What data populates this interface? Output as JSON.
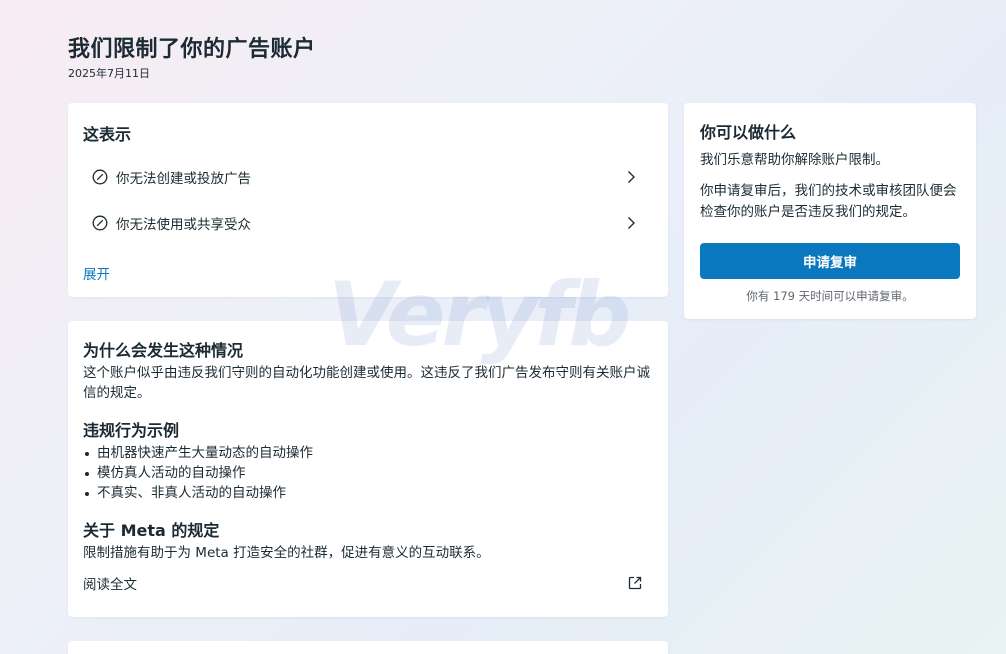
{
  "page": {
    "title": "我们限制了你的广告账户",
    "date": "2025年7月11日"
  },
  "means": {
    "heading": "这表示",
    "items": [
      {
        "label": "你无法创建或投放广告",
        "icon": "ban-icon"
      },
      {
        "label": "你无法使用或共享受众",
        "icon": "ban-icon"
      }
    ],
    "expand_label": "展开"
  },
  "why": {
    "heading": "为什么会发生这种情况",
    "body": "这个账户似乎由违反我们守则的自动化功能创建或使用。这违反了我们广告发布守则有关账户诚信的规定。",
    "examples_heading": "违规行为示例",
    "examples": [
      "由机器快速产生大量动态的自动操作",
      "模仿真人活动的自动操作",
      "不真实、非真人活动的自动操作"
    ],
    "rules_heading": "关于 Meta 的规定",
    "rules_body": "限制措施有助于为 Meta 打造安全的社群，促进有意义的互动联系。",
    "read_label": "阅读全文"
  },
  "what": {
    "heading": "你可以做什么",
    "p1": "我们乐意帮助你解除账户限制。",
    "p2": "你申请复审后，我们的技术或审核团队便会检查你的账户是否违反我们的规定。",
    "button_label": "申请复审",
    "note": "你有 179 天时间可以申请复审。"
  },
  "watermark": "Veryfb",
  "colors": {
    "accent": "#0a78be",
    "text": "#1c2b33",
    "muted": "#606770"
  }
}
